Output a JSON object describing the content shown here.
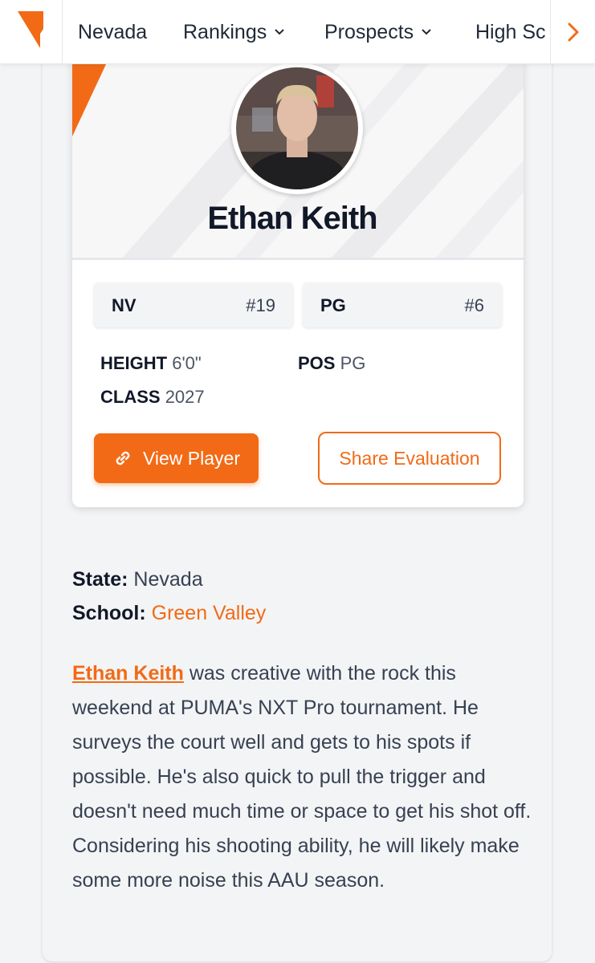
{
  "nav": {
    "items": [
      {
        "label": "Nevada"
      },
      {
        "label": "Rankings"
      },
      {
        "label": "Prospects"
      },
      {
        "label": "High Sc"
      }
    ]
  },
  "player": {
    "name": "Ethan Keith",
    "rankings": [
      {
        "label": "NV",
        "value": "#19"
      },
      {
        "label": "PG",
        "value": "#6"
      }
    ],
    "height_label": "HEIGHT",
    "height": "6'0\"",
    "pos_label": "POS",
    "pos": "PG",
    "class_label": "CLASS",
    "class_year": "2027",
    "view_button": "View Player",
    "share_button": "Share Evaluation"
  },
  "details": {
    "state_label": "State:",
    "state": "Nevada",
    "school_label": "School:",
    "school": "Green Valley"
  },
  "article": {
    "player_link": "Ethan Keith",
    "text": " was creative with the rock this weekend at PUMA's NXT Pro tournament. He surveys the court well and gets to his spots if possible. He's also quick to pull the trigger and doesn't need much time or space to get his shot off. Considering his shooting ability, he will likely make some more noise this AAU season."
  },
  "colors": {
    "accent": "#f26a16",
    "text_dark": "#111827",
    "background": "#f3f4f6"
  }
}
